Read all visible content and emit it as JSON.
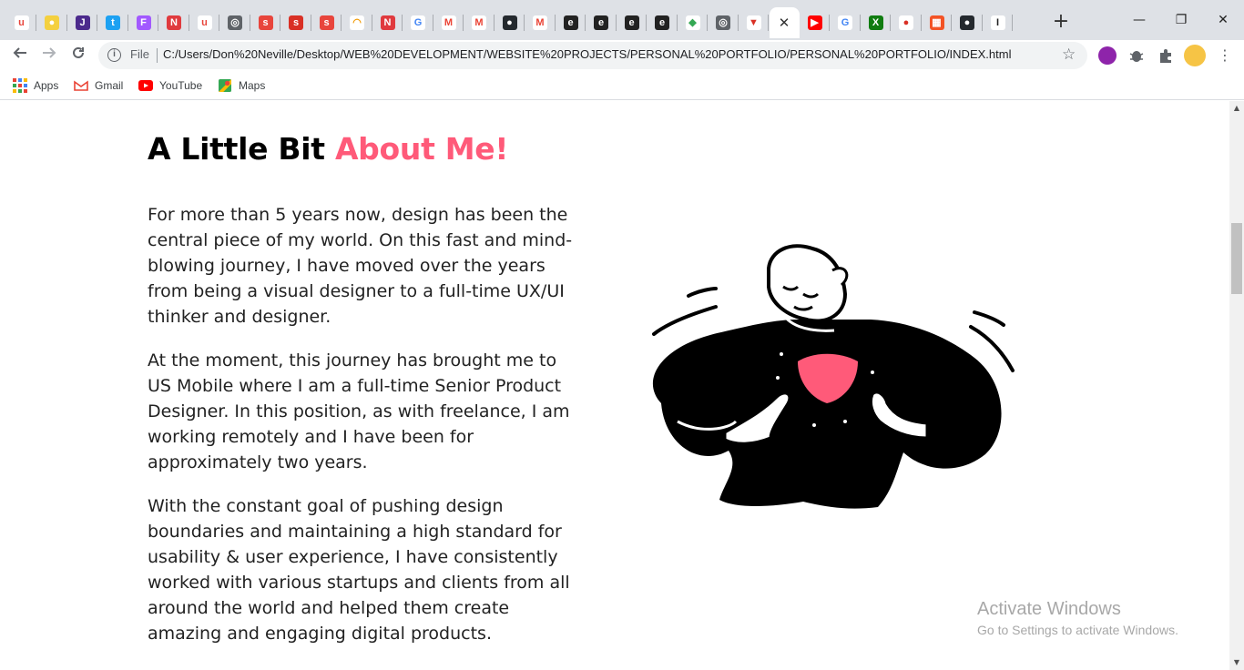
{
  "browser": {
    "tabs": [
      {
        "icon": "u-brand-icon",
        "glyph": "u",
        "bg": "#ffffff",
        "fg": "#e8453c"
      },
      {
        "icon": "extension-icon",
        "glyph": "●",
        "bg": "#f4d03f",
        "fg": "#ffffff"
      },
      {
        "icon": "hex-brand-icon",
        "glyph": "J",
        "bg": "#4b2a8c",
        "fg": "#ffffff"
      },
      {
        "icon": "twitter-icon",
        "glyph": "t",
        "bg": "#1da1f2",
        "fg": "#ffffff"
      },
      {
        "icon": "figma-icon",
        "glyph": "F",
        "bg": "#a259ff",
        "fg": "#ffffff"
      },
      {
        "icon": "n-brand-icon",
        "glyph": "N",
        "bg": "#e03a3e",
        "fg": "#ffffff"
      },
      {
        "icon": "u-brand-icon",
        "glyph": "u",
        "bg": "#ffffff",
        "fg": "#e8453c"
      },
      {
        "icon": "globe-icon",
        "glyph": "◎",
        "bg": "#5f6368",
        "fg": "#ffffff"
      },
      {
        "icon": "red-circle-icon",
        "glyph": "s",
        "bg": "#e8453c",
        "fg": "#ffffff"
      },
      {
        "icon": "red-circle-icon",
        "glyph": "s",
        "bg": "#d93025",
        "fg": "#ffffff"
      },
      {
        "icon": "red-circle-icon",
        "glyph": "s",
        "bg": "#e8453c",
        "fg": "#ffffff"
      },
      {
        "icon": "rainbow-icon",
        "glyph": "◠",
        "bg": "#ffffff",
        "fg": "#f29900"
      },
      {
        "icon": "n-brand-icon",
        "glyph": "N",
        "bg": "#e03a3e",
        "fg": "#ffffff"
      },
      {
        "icon": "google-icon",
        "glyph": "G",
        "bg": "#ffffff",
        "fg": "#4285f4"
      },
      {
        "icon": "gmail-icon",
        "glyph": "M",
        "bg": "#ffffff",
        "fg": "#ea4335"
      },
      {
        "icon": "gmail-icon",
        "glyph": "M",
        "bg": "#ffffff",
        "fg": "#ea4335"
      },
      {
        "icon": "github-icon",
        "glyph": "●",
        "bg": "#24292e",
        "fg": "#ffffff"
      },
      {
        "icon": "gmail-icon",
        "glyph": "M",
        "bg": "#ffffff",
        "fg": "#ea4335"
      },
      {
        "icon": "chimp-icon",
        "glyph": "e",
        "bg": "#222222",
        "fg": "#ffffff"
      },
      {
        "icon": "chimp-icon",
        "glyph": "e",
        "bg": "#222222",
        "fg": "#ffffff"
      },
      {
        "icon": "chimp-icon",
        "glyph": "e",
        "bg": "#222222",
        "fg": "#ffffff"
      },
      {
        "icon": "chimp-icon",
        "glyph": "e",
        "bg": "#222222",
        "fg": "#ffffff"
      },
      {
        "icon": "diamond-icon",
        "glyph": "◆",
        "bg": "#ffffff",
        "fg": "#34a853"
      },
      {
        "icon": "globe-icon",
        "glyph": "◎",
        "bg": "#5f6368",
        "fg": "#ffffff"
      },
      {
        "icon": "shield-icon",
        "glyph": "▼",
        "bg": "#ffffff",
        "fg": "#d93025"
      }
    ],
    "active_tab": {
      "close_glyph": "✕"
    },
    "tabs_after": [
      {
        "icon": "youtube-icon",
        "glyph": "▶",
        "bg": "#ff0000",
        "fg": "#ffffff"
      },
      {
        "icon": "google-icon",
        "glyph": "G",
        "bg": "#ffffff",
        "fg": "#4285f4"
      },
      {
        "icon": "xbox-icon",
        "glyph": "X",
        "bg": "#107c10",
        "fg": "#ffffff"
      },
      {
        "icon": "record-icon",
        "glyph": "●",
        "bg": "#ffffff",
        "fg": "#d93025"
      },
      {
        "icon": "microsoft-icon",
        "glyph": "▦",
        "bg": "#f35325",
        "fg": "#ffffff"
      },
      {
        "icon": "github-icon",
        "glyph": "●",
        "bg": "#24292e",
        "fg": "#ffffff"
      },
      {
        "icon": "cursor-icon",
        "glyph": "I",
        "bg": "#ffffff",
        "fg": "#222222"
      }
    ],
    "new_tab_glyph": "+",
    "window_controls": {
      "minimize": "—",
      "restore": "❐",
      "close": "✕"
    },
    "address": {
      "scheme_label": "File",
      "url": "C:/Users/Don%20Neville/Desktop/WEB%20DEVELOPMENT/WEBSITE%20PROJECTS/PERSONAL%20PORTFOLIO/PERSONAL%20PORTFOLIO/INDEX.html"
    },
    "bookmarks": [
      {
        "label": "Apps",
        "icon": "apps-grid-icon"
      },
      {
        "label": "Gmail",
        "icon": "gmail-icon"
      },
      {
        "label": "YouTube",
        "icon": "youtube-icon"
      },
      {
        "label": "Maps",
        "icon": "maps-icon"
      }
    ]
  },
  "page": {
    "heading_main": "A Little Bit ",
    "heading_accent": "About Me!",
    "accent_color": "#ff5a79",
    "paragraphs": [
      "For more than 5 years now, design has been the central piece of my world. On this fast and mind-blowing journey, I have moved over the years from being a visual designer to a full-time UX/UI thinker and designer.",
      "At the moment, this journey has brought me to US Mobile where I am a full-time Senior Product Designer. In this position, as with freelance, I am working remotely and I have been for approximately two years.",
      "With the constant goal of pushing design boundaries and maintaining a high standard for usability & user experience, I have consistently worked with various startups and clients from all around the world and helped them create amazing and engaging digital products."
    ]
  },
  "os": {
    "watermark_title": "Activate Windows",
    "watermark_subtitle": "Go to Settings to activate Windows."
  }
}
